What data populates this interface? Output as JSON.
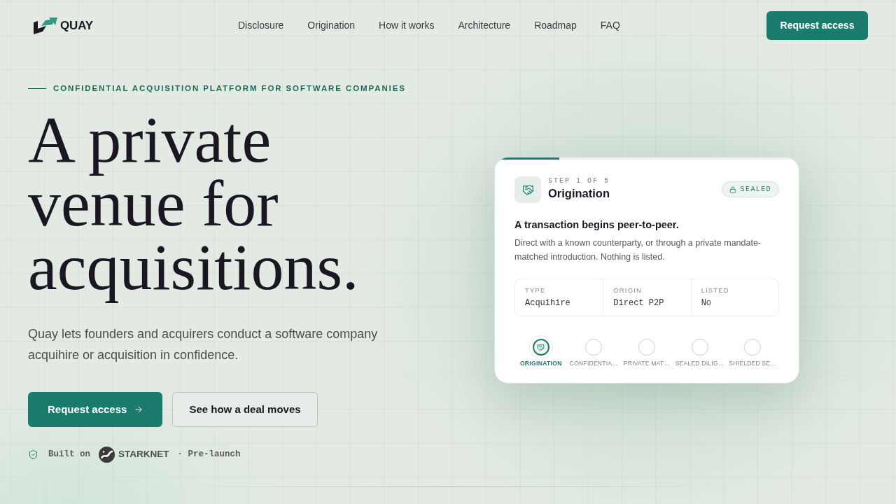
{
  "nav": {
    "brand": "QUAY",
    "links": [
      "Disclosure",
      "Origination",
      "How it works",
      "Architecture",
      "Roadmap",
      "FAQ"
    ],
    "cta": "Request access"
  },
  "hero": {
    "eyebrow": "CONFIDENTIAL ACQUISITION PLATFORM FOR SOFTWARE COMPANIES",
    "headline": [
      "A private",
      "venue for",
      "acquisitions."
    ],
    "lede": "Quay lets founders and acquirers conduct a software company acquihire or acquisition in confidence.",
    "buttons": [
      {
        "kind": "primary",
        "label": "Request access"
      },
      {
        "kind": "secondary",
        "label": "See how a deal moves"
      }
    ],
    "footnote": {
      "built_on": "Built on",
      "platform": "STARKNET",
      "status": "· Pre-launch"
    }
  },
  "card": {
    "progress": {
      "level": 0.2
    },
    "step": "STEP 1 OF 5",
    "title": "Origination",
    "badge": "SEALED",
    "heading": "A transaction begins peer-to-peer.",
    "description": "Direct with a known counterparty, or through a private mandate-matched introduction. Nothing is listed.",
    "facts": [
      {
        "label": "TYPE",
        "value": "Acquihire"
      },
      {
        "label": "ORIGIN",
        "value": "Direct P2P"
      },
      {
        "label": "LISTED",
        "value": "No"
      }
    ],
    "steps": [
      {
        "label": "ORIGINATION",
        "selected": true
      },
      {
        "label": "CONFIDENTIA…",
        "selected": false
      },
      {
        "label": "PRIVATE MAT…",
        "selected": false
      },
      {
        "label": "SEALED DILIG…",
        "selected": false
      },
      {
        "label": "SHIELDED SE…",
        "selected": false
      }
    ]
  }
}
